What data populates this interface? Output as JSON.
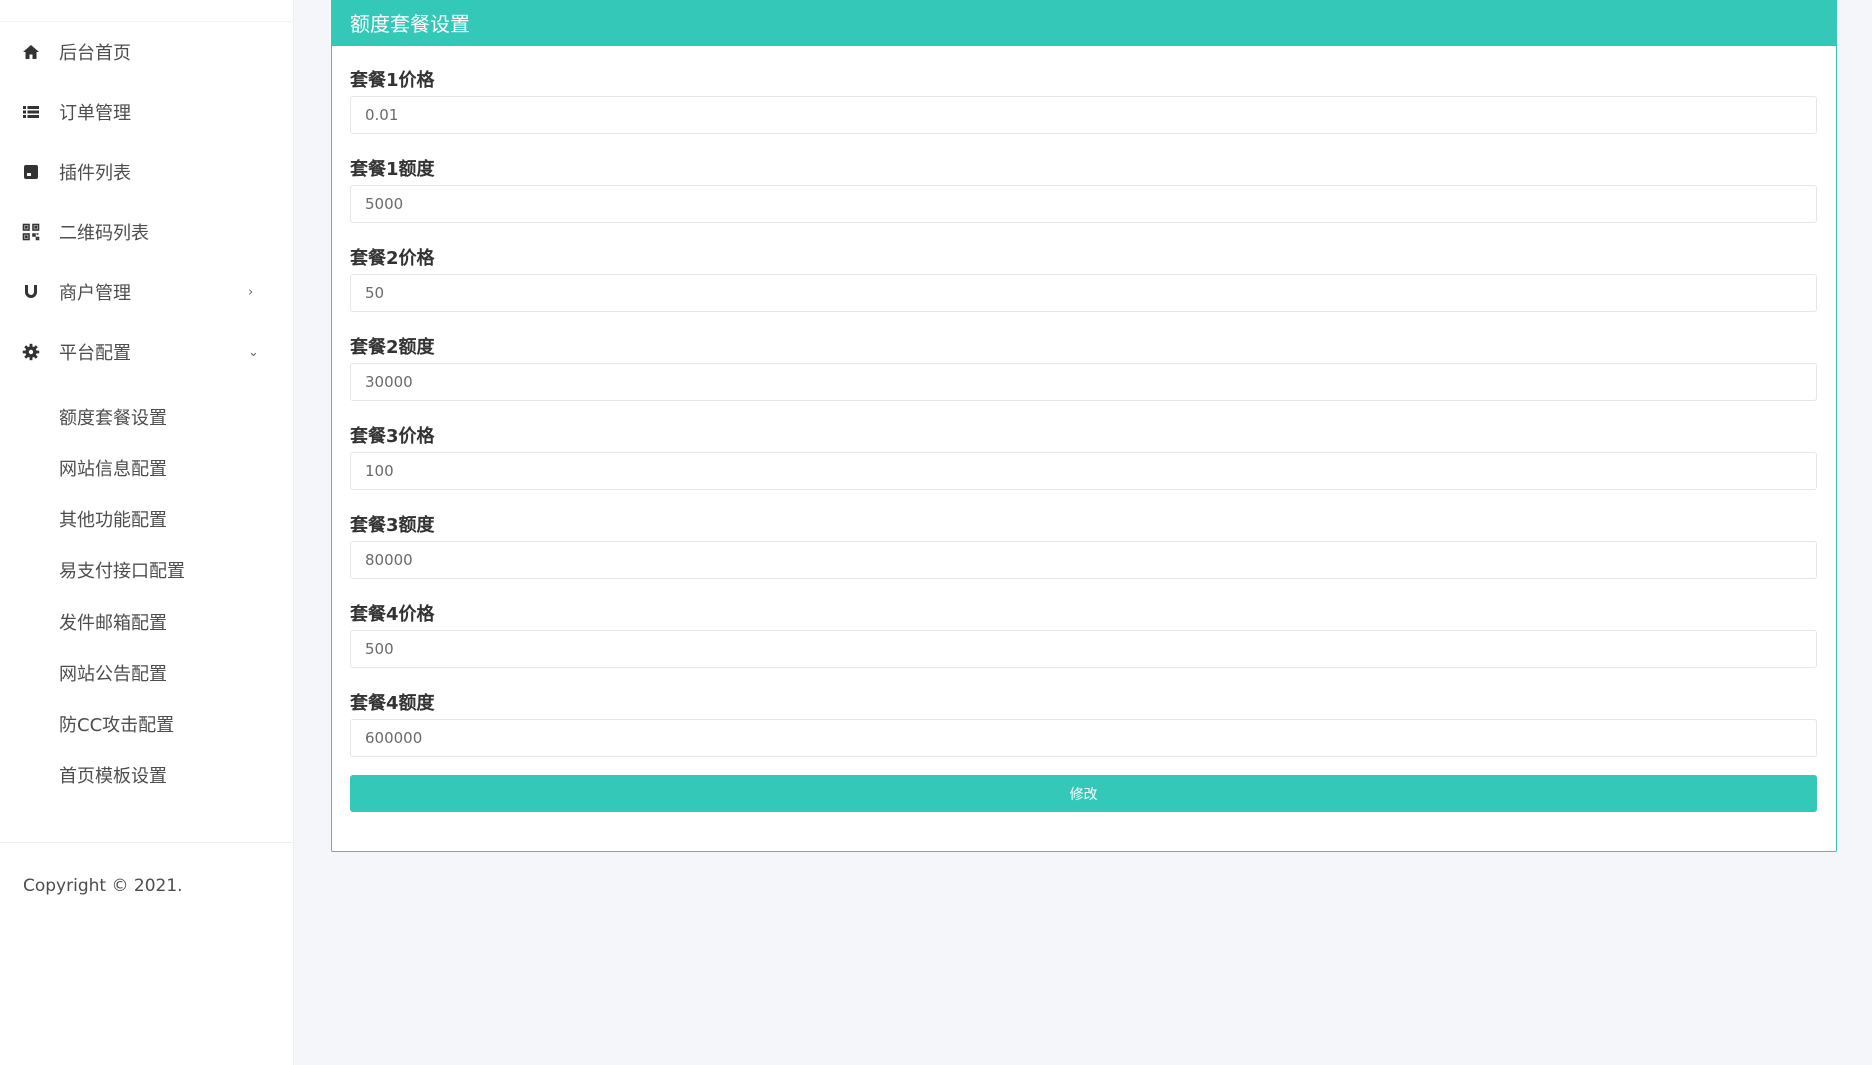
{
  "sidebar": {
    "items": [
      {
        "label": "后台首页",
        "icon": "home-icon"
      },
      {
        "label": "订单管理",
        "icon": "list-icon"
      },
      {
        "label": "插件列表",
        "icon": "plugin-icon"
      },
      {
        "label": "二维码列表",
        "icon": "qrcode-icon"
      },
      {
        "label": "商户管理",
        "icon": "magnet-icon",
        "arrow": "›"
      },
      {
        "label": "平台配置",
        "icon": "gear-icon",
        "arrow": "⌄"
      }
    ],
    "subitems": [
      {
        "label": "额度套餐设置"
      },
      {
        "label": "网站信息配置"
      },
      {
        "label": "其他功能配置"
      },
      {
        "label": "易支付接口配置"
      },
      {
        "label": "发件邮箱配置"
      },
      {
        "label": "网站公告配置"
      },
      {
        "label": "防CC攻击配置"
      },
      {
        "label": "首页模板设置"
      }
    ],
    "copyright": "Copyright © 2021."
  },
  "panel": {
    "title": "额度套餐设置",
    "fields": [
      {
        "label": "套餐1价格",
        "value": "0.01"
      },
      {
        "label": "套餐1额度",
        "value": "5000"
      },
      {
        "label": "套餐2价格",
        "value": "50"
      },
      {
        "label": "套餐2额度",
        "value": "30000"
      },
      {
        "label": "套餐3价格",
        "value": "100"
      },
      {
        "label": "套餐3额度",
        "value": "80000"
      },
      {
        "label": "套餐4价格",
        "value": "500"
      },
      {
        "label": "套餐4额度",
        "value": "600000"
      }
    ],
    "submit_label": "修改"
  },
  "colors": {
    "accent": "#34c8b9",
    "background": "#f4f6fa"
  }
}
